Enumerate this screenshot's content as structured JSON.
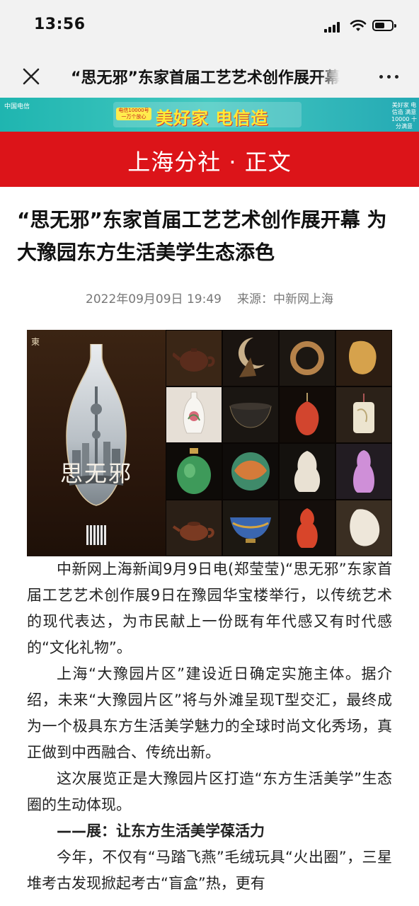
{
  "status_bar": {
    "time": "13:56",
    "battery_level": 0.6
  },
  "nav": {
    "title": "“思无邪”东家首届工艺艺术创作展开幕",
    "close_icon": "close-icon",
    "more_icon": "more-icon"
  },
  "ad_banner": {
    "brand": "中国电信",
    "tag": "电信10000号 一万个放心",
    "slogan": "美好家 电信造",
    "right_text": "美好家 电信造 满意10000 十分满意",
    "colors": {
      "background": "#2bb8b2",
      "slogan": "#ffe936"
    }
  },
  "section": {
    "title": "上海分社 · 正文",
    "color": "#dc1419"
  },
  "article": {
    "headline": "“思无邪”东家首届工艺艺术创作展开幕 为大豫园东方生活美学生态添色",
    "date": "2022年09月09日 19:49",
    "source": "来源：中新网上海",
    "image": {
      "poster_label": "東",
      "poster_title": "思无邪"
    },
    "paragraphs": [
      "中新网上海新闻9月9日电(郑莹莹)“思无邪”东家首届工艺艺术创作展9日在豫园华宝楼举行，以传统艺术的现代表达，为市民献上一份既有年代感又有时代感的“文化礼物”。",
      "上海“大豫园片区”建设近日确定实施主体。据介绍，未来“大豫园片区”将与外滩呈现T型交汇，最终成为一个极具东方生活美学魅力的全球时尚文化秀场，真正做到中西融合、传统出新。",
      "这次展览正是大豫园片区打造“东方生活美学”生态圈的生动体现。"
    ],
    "subheading": "——展：让东方生活美学葆活力",
    "paragraph_last": "今年，不仅有“马踏飞燕”毛绒玩具“火出圈”，三星堆考古发现掀起考古“盲盒”热，更有"
  }
}
